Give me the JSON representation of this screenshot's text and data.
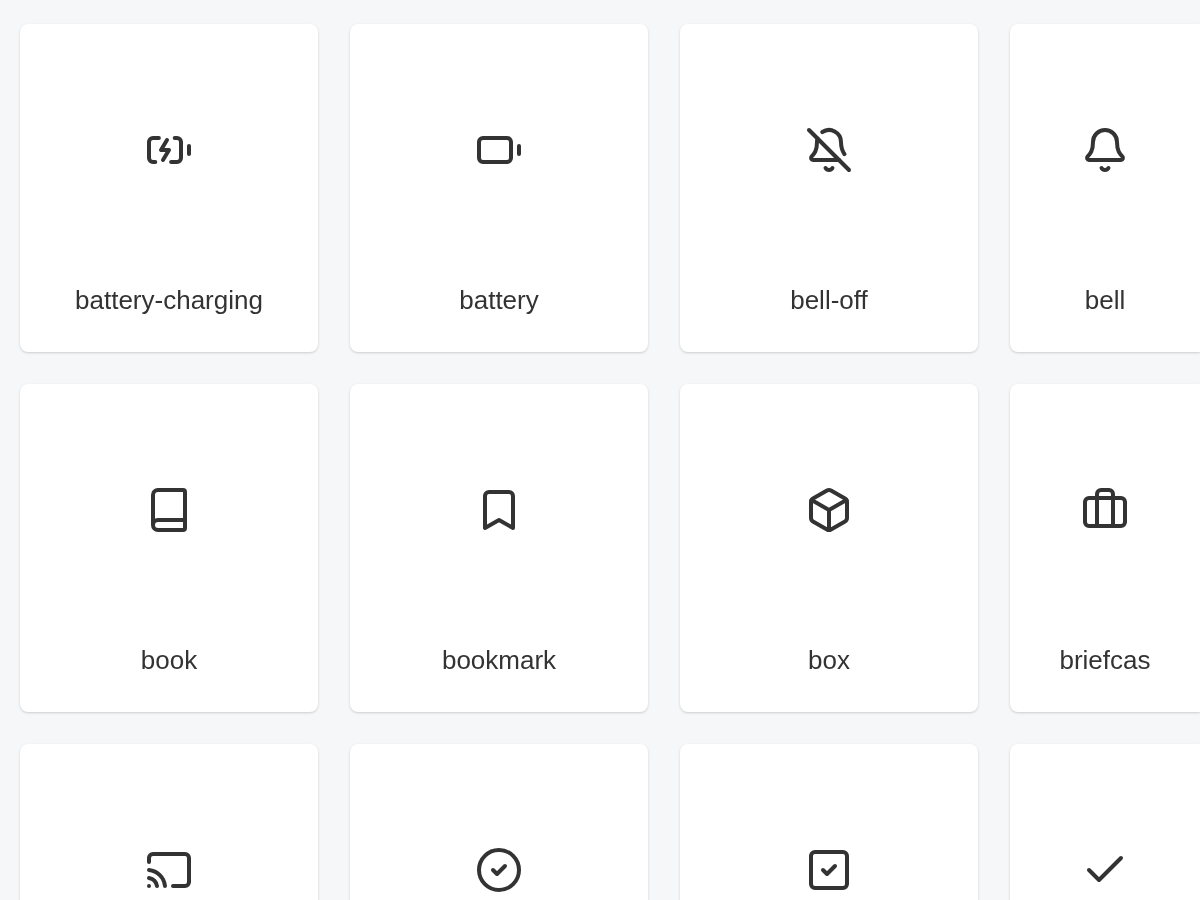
{
  "cards": [
    {
      "label": "battery-charging"
    },
    {
      "label": "battery"
    },
    {
      "label": "bell-off"
    },
    {
      "label": "bell"
    },
    {
      "label": "book"
    },
    {
      "label": "bookmark"
    },
    {
      "label": "box"
    },
    {
      "label": "briefcas"
    }
  ]
}
